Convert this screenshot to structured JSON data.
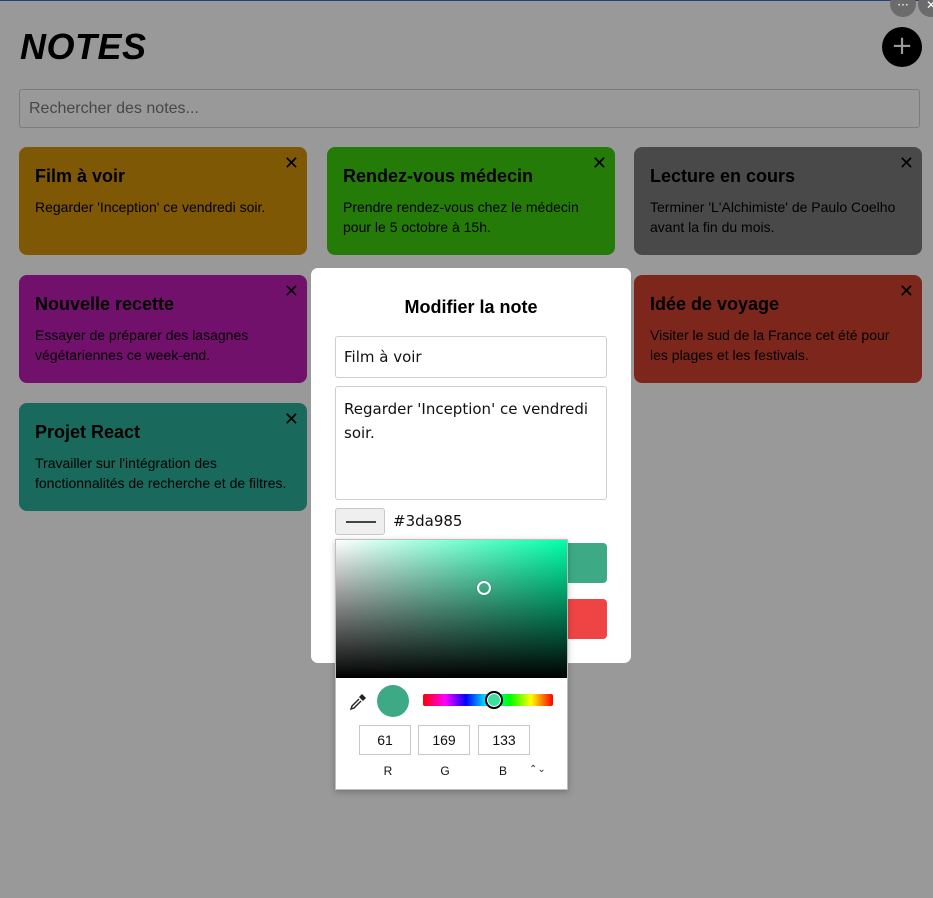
{
  "app": {
    "title": "NOTES",
    "add_button": "+"
  },
  "search": {
    "placeholder": "Rechercher des notes..."
  },
  "notes": [
    {
      "title": "Film à voir",
      "content": "Regarder 'Inception' ce vendredi soir.",
      "color": "#d4930a"
    },
    {
      "title": "Rendez-vous médecin",
      "content": "Prendre rendez-vous chez le médecin pour le 5 octobre à 15h.",
      "color": "#3fce0c"
    },
    {
      "title": "Lecture en cours",
      "content": "Terminer 'L'Alchimiste' de Paulo Coelho avant la fin du mois.",
      "color": "#7b7b7b"
    },
    {
      "title": "Nouvelle recette",
      "content": "Essayer de préparer des lasagnes végétariennes ce week-end.",
      "color": "#be1db3"
    },
    {
      "title": "Idée de voyage",
      "content": "Visiter le sud de la France cet été pour les plages et les festivals.",
      "color": "#d1402f"
    },
    {
      "title": "Projet React",
      "content": "Travailler sur l'intégration des fonctionnalités de recherche et de filtres.",
      "color": "#2bb09a"
    }
  ],
  "close_glyph": "✕",
  "corner_buttons": {
    "more": "···",
    "close": "✕"
  },
  "modal": {
    "title": "Modifier la note",
    "note_title_value": "Film à voir",
    "note_content_value": "Regarder 'Inception' ce vendredi soir.",
    "color_hex": "#3da985",
    "save_color": "#3da985",
    "delete_color": "#ef4444"
  },
  "color_picker": {
    "r": "61",
    "g": "169",
    "b": "133",
    "r_label": "R",
    "g_label": "G",
    "b_label": "B",
    "mode_toggle": "⌃⌄",
    "icon": "eyedropper-icon"
  }
}
